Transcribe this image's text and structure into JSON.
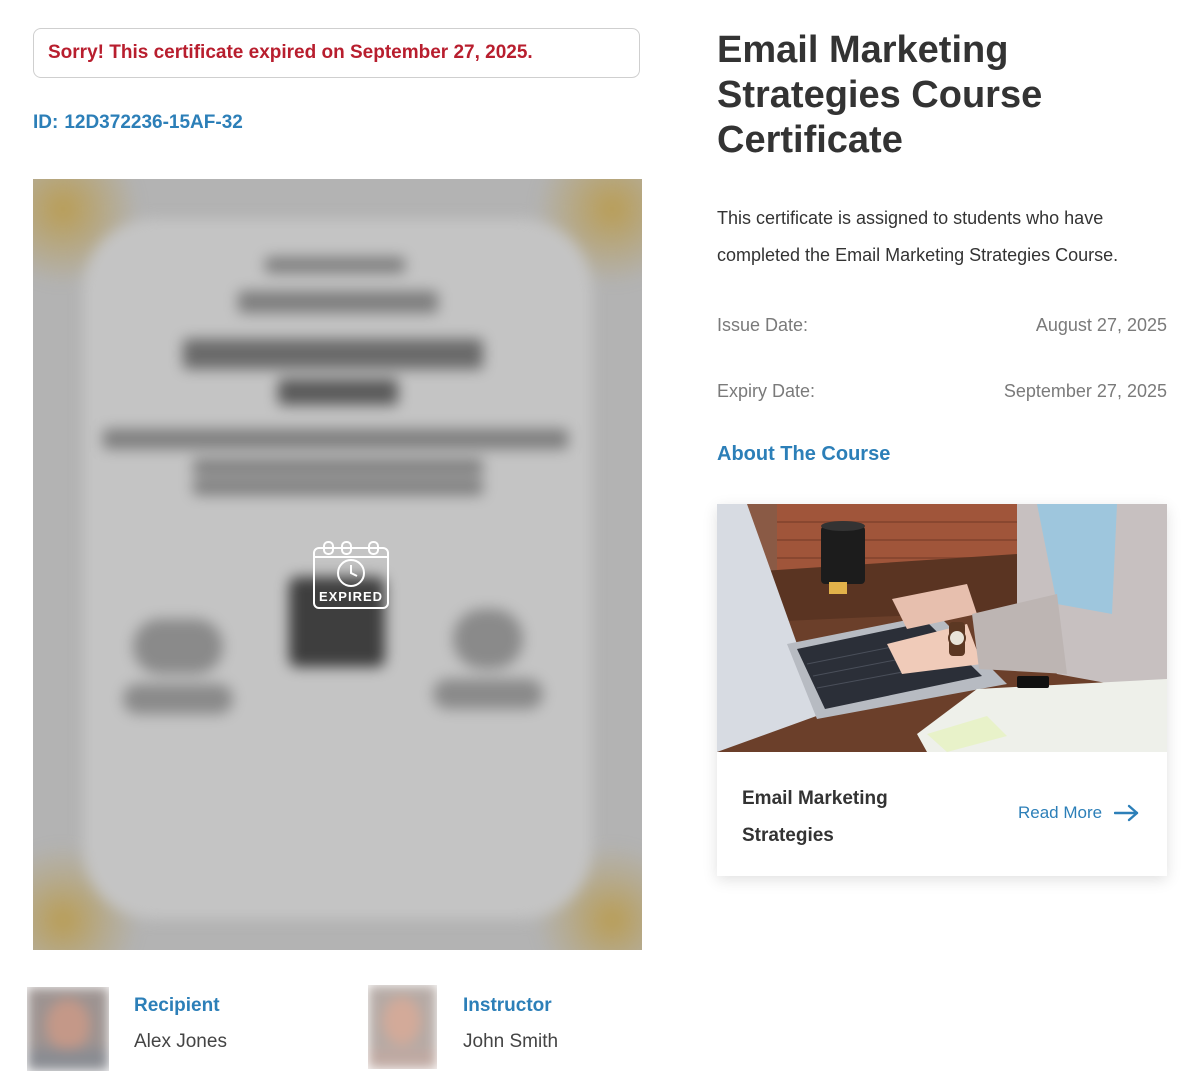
{
  "alert": {
    "message": "Sorry! This certificate expired on September 27, 2025."
  },
  "certificate": {
    "id_label": "ID:",
    "id_value": "12D372236-15AF-32",
    "status_icon": "expired-calendar-icon",
    "status_label": "EXPIRED"
  },
  "details": {
    "title": "Email Marketing Strategies Course Certificate",
    "description": "This certificate is assigned to students who have completed the Email Marketing Strategies Course.",
    "issue_label": "Issue Date:",
    "issue_value": "August 27, 2025",
    "expiry_label": "Expiry Date:",
    "expiry_value": "September 27, 2025",
    "about_link": "About The Course"
  },
  "course": {
    "name": "Email Marketing Strategies",
    "read_more": "Read More",
    "read_more_icon": "arrow-right-icon"
  },
  "people": {
    "recipient": {
      "role": "Recipient",
      "name": "Alex Jones"
    },
    "instructor": {
      "role": "Instructor",
      "name": "John Smith"
    }
  },
  "colors": {
    "accent": "#2c7fb8",
    "alert_text": "#b81e2e",
    "heading": "#333333",
    "muted": "#7a7a7a"
  }
}
